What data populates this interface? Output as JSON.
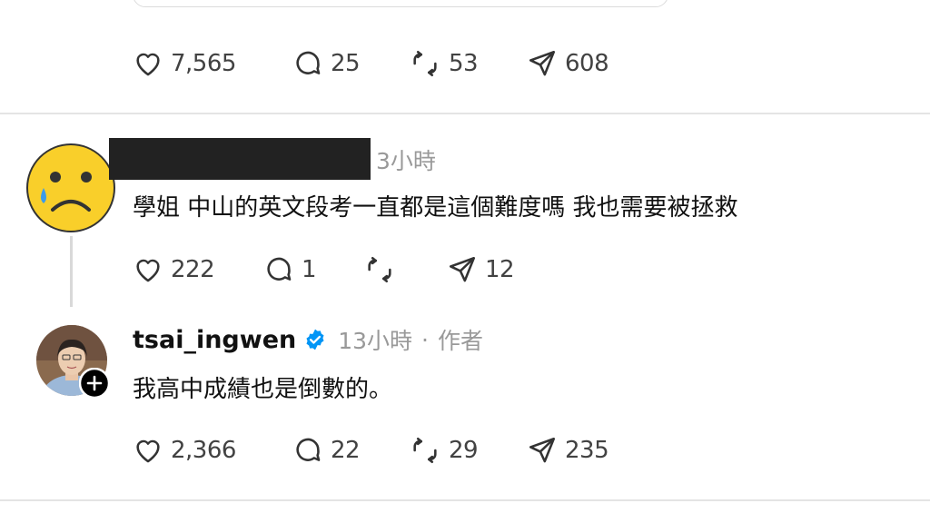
{
  "top_post": {
    "actions": {
      "likes": "7,565",
      "replies": "25",
      "reposts": "53",
      "shares": "608"
    }
  },
  "reply_1": {
    "avatar_icon": "crying-face-emoji-icon",
    "time": "3小時",
    "text": "學姐 中山的英文段考一直都是這個難度嗎 我也需要被拯救",
    "actions": {
      "likes": "222",
      "replies": "1",
      "reposts": "",
      "shares": "12"
    }
  },
  "reply_2": {
    "username": "tsai_ingwen",
    "verified_icon": "verified-badge-icon",
    "time": "13小時",
    "separator": "·",
    "author_label": "作者",
    "text": "我高中成績也是倒數的。",
    "actions": {
      "likes": "2,366",
      "replies": "22",
      "reposts": "29",
      "shares": "235"
    }
  },
  "colors": {
    "verified_blue": "#0095f6",
    "muted_text": "#999999",
    "divider": "#e4e4e4",
    "emoji_yellow": "#f9cf2a"
  }
}
